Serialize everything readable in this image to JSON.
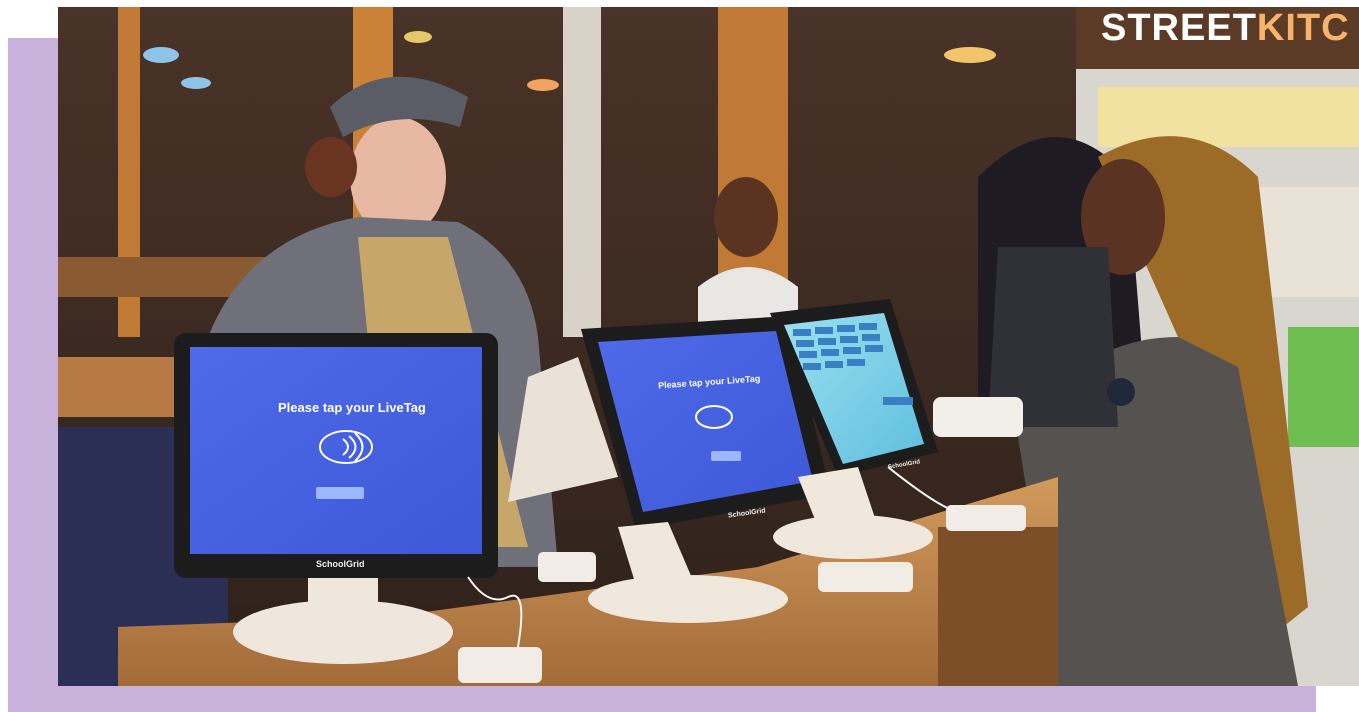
{
  "scene": {
    "description_free": true,
    "frame_color": "#c8b1da"
  },
  "kiosk_left": {
    "prompt": "Please tap your LiveTag",
    "brand": "SchoolGrid",
    "screen_color": "#4a67e6",
    "icon": "contactless-icon"
  },
  "kiosk_middle": {
    "prompt": "Please tap your LiveTag",
    "brand": "SchoolGrid",
    "screen_color": "#4d6de9",
    "icon": "contactless-icon"
  },
  "kiosk_right": {
    "brand": "SchoolGrid",
    "screen_color": "#7fd1e6"
  },
  "sign": {
    "text_main": "STREET",
    "text_partial": "KITC"
  }
}
